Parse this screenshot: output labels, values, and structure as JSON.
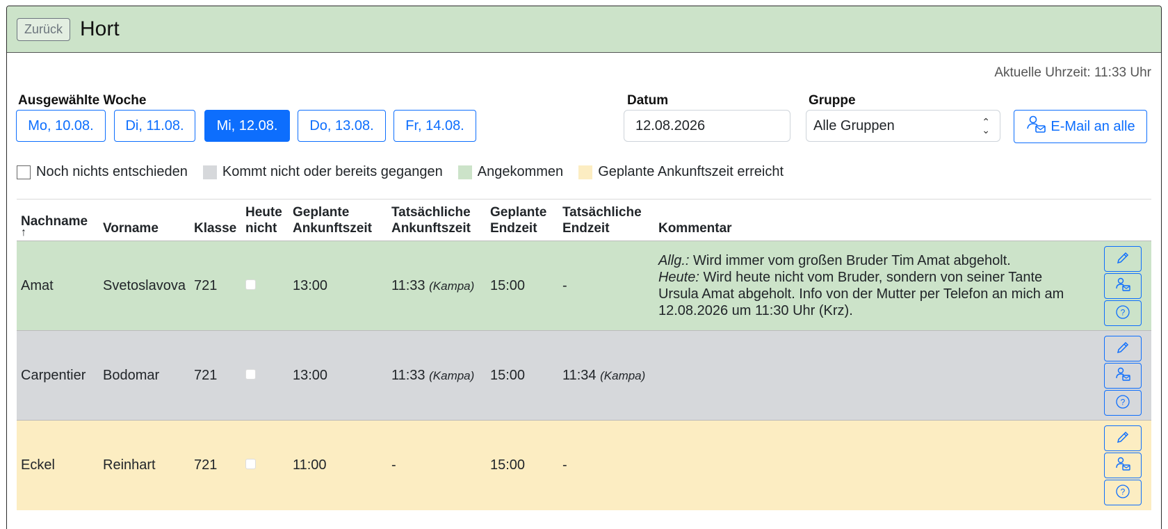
{
  "header": {
    "back_label": "Zurück",
    "title": "Hort"
  },
  "clock": "Aktuelle Uhrzeit: 11:33 Uhr",
  "week": {
    "label": "Ausgewählte Woche",
    "days": [
      "Mo, 10.08.",
      "Di, 11.08.",
      "Mi, 12.08.",
      "Do, 13.08.",
      "Fr, 14.08."
    ],
    "active_index": 2
  },
  "date": {
    "label": "Datum",
    "value": "12.08.2026"
  },
  "group": {
    "label": "Gruppe",
    "value": "Alle Gruppen"
  },
  "mail_all_label": "E-Mail an alle",
  "legend": [
    {
      "label": "Noch nichts entschieden",
      "color": "#ffffff"
    },
    {
      "label": "Kommt nicht oder bereits gegangen",
      "color": "#d6d8db"
    },
    {
      "label": "Angekommen",
      "color": "#cce3c9"
    },
    {
      "label": "Geplante Ankunftszeit erreicht",
      "color": "#fcedc2"
    }
  ],
  "table": {
    "headers": {
      "nachname": "Nachname",
      "vorname": "Vorname",
      "klasse": "Klasse",
      "heute1": "Heute",
      "heute2": "nicht",
      "gan1": "Geplante",
      "gan2": "Ankunftszeit",
      "tan1": "Tatsächliche",
      "tan2": "Ankunftszeit",
      "gend1": "Geplante",
      "gend2": "Endzeit",
      "tend1": "Tatsächliche",
      "tend2": "Endzeit",
      "kommentar": "Kommentar",
      "sort_arrow": "↑"
    },
    "rows": [
      {
        "nachname": "Amat",
        "vorname": "Svetoslavova",
        "klasse": "721",
        "geplante_ankunft": "13:00",
        "tats_ankunft": "11:33",
        "tats_ankunft_by": "(Kampa)",
        "geplante_end": "15:00",
        "tats_end": "-",
        "tats_end_by": "",
        "comment_allg_label": "Allg.:",
        "comment_allg": " Wird immer vom großen Bruder Tim Amat abgeholt.",
        "comment_heute_label": "Heute:",
        "comment_heute": " Wird heute nicht vom Bruder, sondern von seiner Tante Ursula Amat abgeholt. Info von der Mutter per Telefon an mich am 12.08.2026 um 11:30 Uhr (Krz).",
        "status": "green"
      },
      {
        "nachname": "Carpentier",
        "vorname": "Bodomar",
        "klasse": "721",
        "geplante_ankunft": "13:00",
        "tats_ankunft": "11:33",
        "tats_ankunft_by": "(Kampa)",
        "geplante_end": "15:00",
        "tats_end": "11:34",
        "tats_end_by": "(Kampa)",
        "status": "grey"
      },
      {
        "nachname": "Eckel",
        "vorname": "Reinhart",
        "klasse": "721",
        "geplante_ankunft": "11:00",
        "tats_ankunft": "-",
        "tats_ankunft_by": "",
        "geplante_end": "15:00",
        "tats_end": "-",
        "tats_end_by": "",
        "status": "yellow"
      }
    ]
  },
  "icons": {
    "edit": "pencil-icon",
    "mail": "person-mail-icon",
    "help": "question-circle-icon"
  },
  "colors": {
    "accent": "#0d6efd",
    "header_bg": "#cce3c9"
  }
}
